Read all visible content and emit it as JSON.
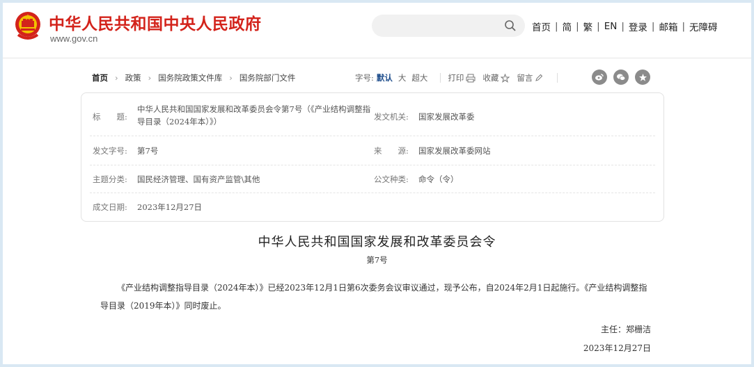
{
  "header": {
    "site_title": "中华人民共和国中央人民政府",
    "site_url": "www.gov.cn",
    "search_placeholder": "",
    "nav": [
      "首页",
      "简",
      "繁",
      "EN",
      "登录",
      "邮箱",
      "无障碍"
    ]
  },
  "breadcrumb": {
    "items": [
      "首页",
      "政策",
      "国务院政策文件库",
      "国务院部门文件"
    ]
  },
  "tools": {
    "font_label": "字号:",
    "font_options": [
      "默认",
      "大",
      "超大"
    ],
    "active_font": "默认",
    "print": "打印",
    "favorite": "收藏",
    "comment": "留言"
  },
  "share": [
    "weibo-icon",
    "wechat-icon",
    "star-icon"
  ],
  "info": {
    "title_label": "标　　题:",
    "title_value": "中华人民共和国国家发展和改革委员会令第7号（《产业结构调整指导目录（2024年本）》）",
    "issuer_label": "发文机关:",
    "issuer_value": "国家发展改革委",
    "doc_no_label": "发文字号:",
    "doc_no_value": "第7号",
    "source_label": "来　　源:",
    "source_value": "国家发展改革委网站",
    "topic_label": "主题分类:",
    "topic_value": "国民经济管理、国有资产监管\\其他",
    "type_label": "公文种类:",
    "type_value": "命令（令）",
    "date_label": "成文日期:",
    "date_value": "2023年12月27日"
  },
  "doc": {
    "title": "中华人民共和国国家发展和改革委员会令",
    "number": "第7号",
    "body": "《产业结构调整指导目录（2024年本）》已经2023年12月1日第6次委务会议审议通过，现予公布，自2024年2月1日起施行。《产业结构调整指导目录（2019年本）》同时废止。",
    "signature": "主任：郑栅洁",
    "date": "2023年12月27日"
  },
  "colors": {
    "brand_red": "#d3231b",
    "accent_blue": "#1f4e8c",
    "icon_gray": "#8b8b8b"
  }
}
